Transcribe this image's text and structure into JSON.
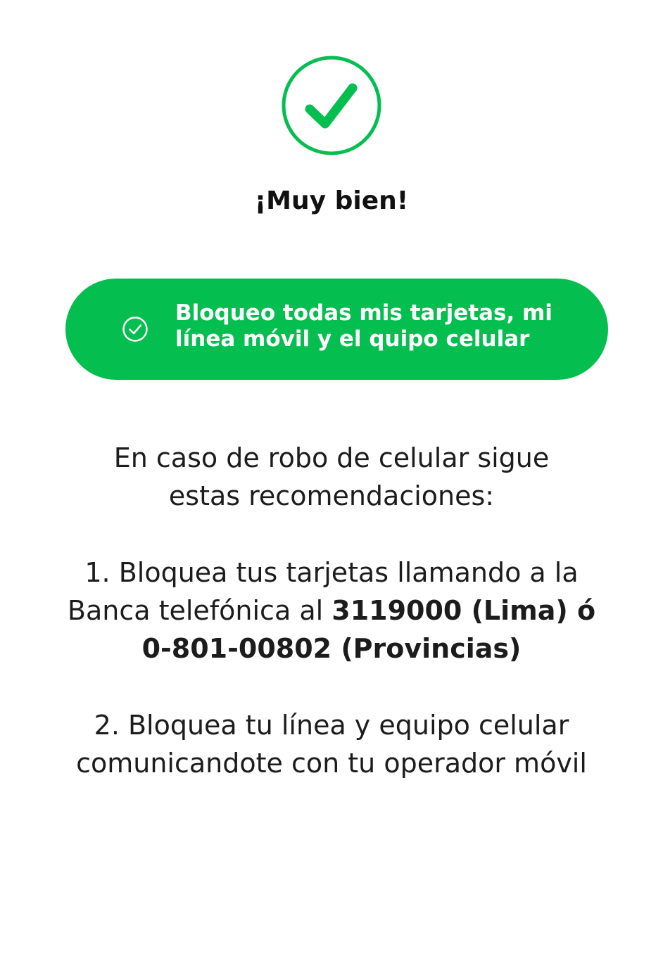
{
  "colors": {
    "brand_green": "#05be50",
    "text_dark": "#1c1c1c",
    "background": "#ffffff"
  },
  "icons": {
    "success": "check-circle-icon",
    "button": "check-circle-outline-icon"
  },
  "header": {
    "title": "¡Muy bien!"
  },
  "action": {
    "line1": "Bloqueo todas mis tarjetas, mi",
    "line2": "línea móvil y el quipo celular"
  },
  "recommendations": {
    "intro_line1": "En caso de robo de celular sigue",
    "intro_line2": "estas recomendaciones:",
    "step1_line1": "1. Bloquea tus tarjetas llamando a la",
    "step1_line2_prefix": "Banca telefónica al ",
    "step1_line2_strong": "3119000 (Lima) ó",
    "step1_line3_strong": "0-801-00802 (Provincias)",
    "step2_line1": "2. Bloquea tu línea y equipo celular",
    "step2_line2": "comunicandote con tu operador móvil"
  }
}
